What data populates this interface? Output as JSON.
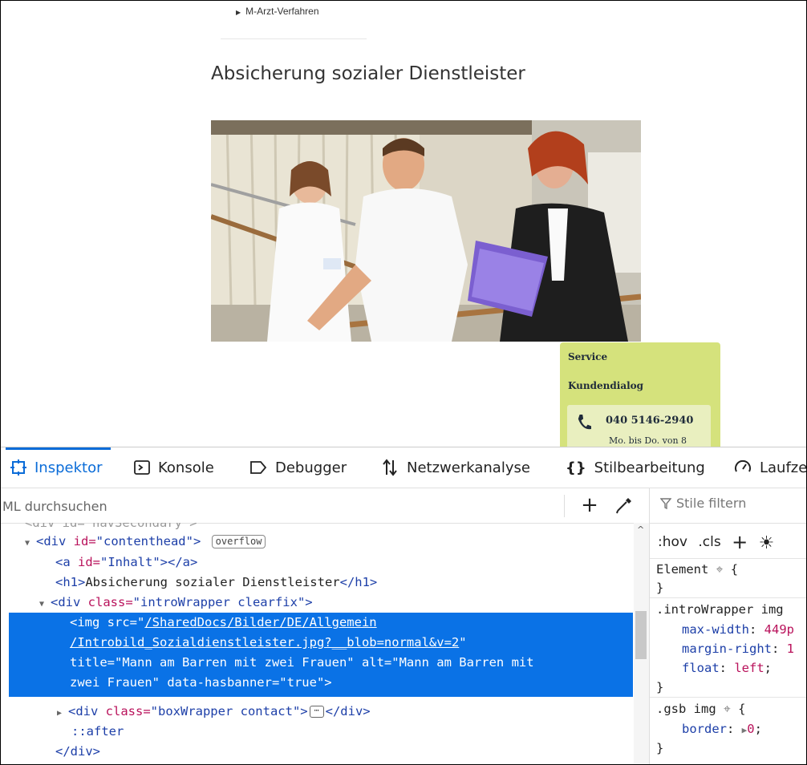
{
  "page": {
    "nav_item": "M-Arzt-Verfahren",
    "title": "Absicherung sozialer Dienstleister",
    "service": {
      "heading": "Service",
      "subheading": "Kundendialog",
      "phone": "040 5146-2940",
      "hours": "Mo. bis Do. von 8"
    }
  },
  "devtools": {
    "tabs": [
      {
        "label": "Inspektor",
        "icon": "inspector-icon"
      },
      {
        "label": "Konsole",
        "icon": "console-icon"
      },
      {
        "label": "Debugger",
        "icon": "debugger-icon"
      },
      {
        "label": "Netzwerkanalyse",
        "icon": "network-icon"
      },
      {
        "label": "Stilbearbeitung",
        "icon": "braces-icon"
      },
      {
        "label": "Laufze",
        "icon": "performance-icon"
      }
    ],
    "search_placeholder": "ML durchsuchen",
    "filter_placeholder": "Stile filtern",
    "rules_toolbar": {
      "hov": ":hov",
      "cls": ".cls"
    },
    "markup": {
      "line0": "<div id=\"navSecondary\">",
      "l1_tag_open": "<div",
      "l1_attr": " id=",
      "l1_val": "\"contenthead\"",
      "l1_close": ">",
      "l1_badge": "overflow",
      "l2_tag": "<a",
      "l2_attr": " id=",
      "l2_val": "\"Inhalt\"",
      "l2_close": "></a>",
      "l3_open": "<h1>",
      "l3_text": "Absicherung sozialer Dienstleister",
      "l3_close": "</h1>",
      "l4_tag": "<div",
      "l4_attr": " class=",
      "l4_val": "\"introWrapper clearfix\"",
      "l4_close": ">",
      "sel_line1_a": "<img src=\"",
      "sel_line1_b": "/SharedDocs/Bilder/DE/Allgemein",
      "sel_line2_a": "/Introbild_Sozialdienstleister.jpg?__blob=normal&v=2",
      "sel_line2_b": "\"",
      "sel_line3": "title=\"Mann am Barren mit zwei Frauen\" alt=\"Mann am Barren mit",
      "sel_line4": "zwei Frauen\" data-hasbanner=\"true\">",
      "l9_tag": "<div",
      "l9_attr": " class=",
      "l9_val": "\"boxWrapper contact\"",
      "l9_close": ">",
      "l9_end": "</div>",
      "l10": "::after",
      "l11": "</div>"
    },
    "rules": {
      "element_sel": "Element",
      "brace_open": "{",
      "brace_close": "}",
      "r2_sel": ".introWrapper img",
      "r2_p1": "max-width",
      "r2_v1": "449p",
      "r2_p2": "margin-right",
      "r2_v2": "1",
      "r2_p3": "float",
      "r2_v3": "left",
      "r3_sel": ".gsb img",
      "r3_p1": "border",
      "r3_v1": "0"
    }
  }
}
